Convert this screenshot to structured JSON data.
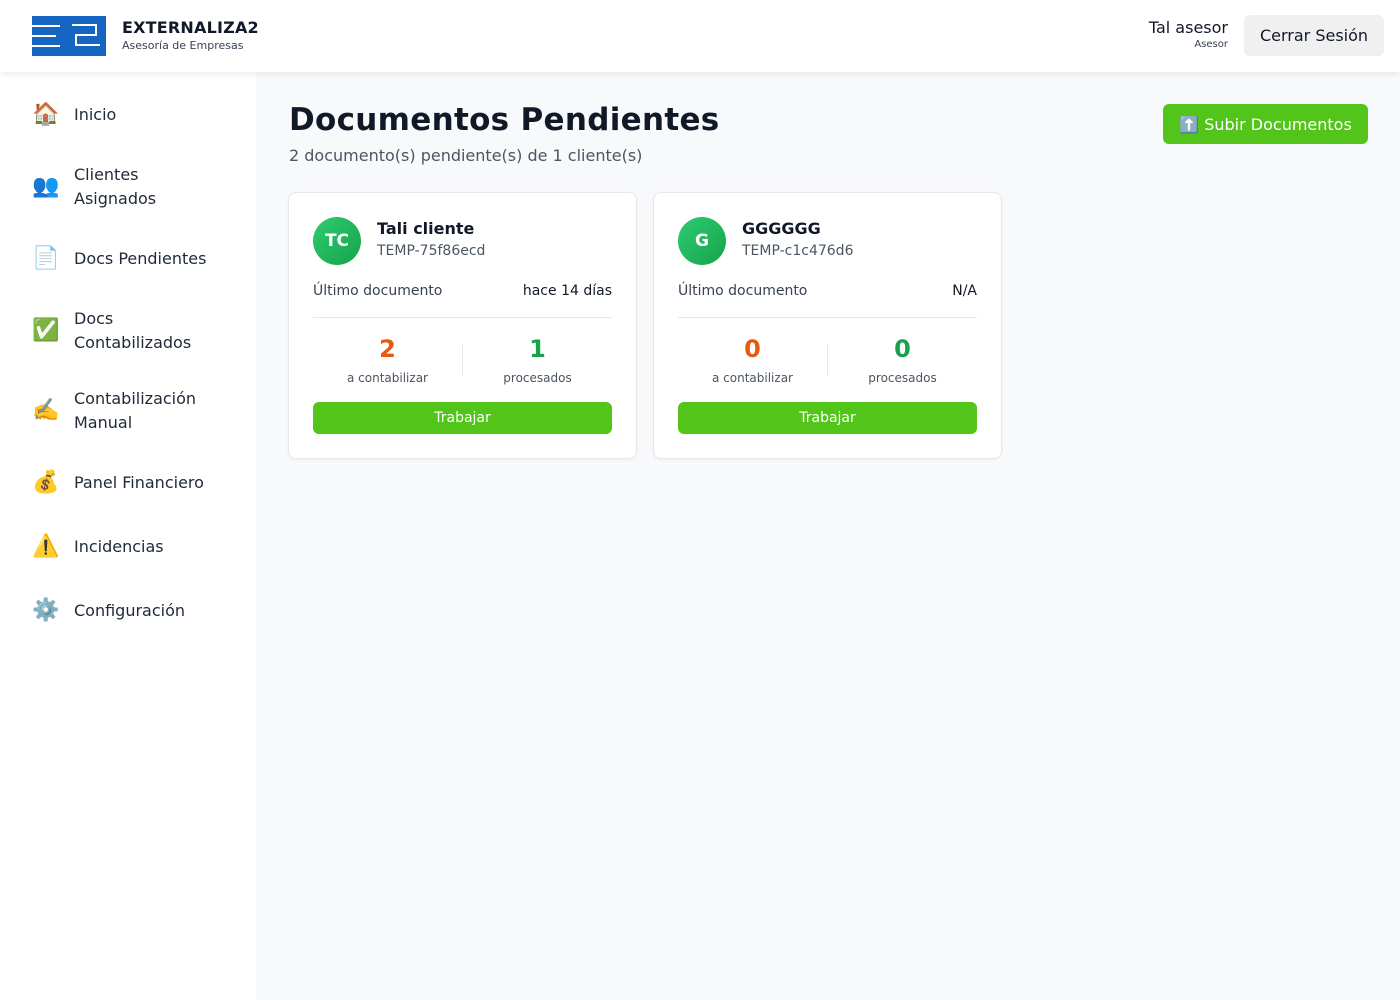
{
  "header": {
    "brand_name": "EXTERNALIZA2",
    "brand_sub": "Asesoría de Empresas",
    "user_name": "Tal asesor",
    "user_role": "Asesor",
    "logout_label": "Cerrar Sesión",
    "brand_color": "#1565c0"
  },
  "sidebar": {
    "items": [
      {
        "icon": "house-icon",
        "glyph": "🏠",
        "label": "Inicio"
      },
      {
        "icon": "users-icon",
        "glyph": "👥",
        "label": "Clientes Asignados"
      },
      {
        "icon": "document-icon",
        "glyph": "📄",
        "label": "Docs Pendientes"
      },
      {
        "icon": "check-icon",
        "glyph": "✅",
        "label": "Docs Contabilizados"
      },
      {
        "icon": "writing-hand-icon",
        "glyph": "✍️",
        "label": "Contabilización Manual"
      },
      {
        "icon": "money-bag-icon",
        "glyph": "💰",
        "label": "Panel Financiero"
      },
      {
        "icon": "warning-icon",
        "glyph": "⚠️",
        "label": "Incidencias"
      },
      {
        "icon": "gear-icon",
        "glyph": "⚙️",
        "label": "Configuración"
      }
    ]
  },
  "main": {
    "title": "Documentos Pendientes",
    "subtitle": "2 documento(s) pendiente(s) de 1 cliente(s)",
    "upload_icon": "⬆️",
    "upload_label": "Subir Documentos",
    "accent_color": "#52c41a",
    "cards": [
      {
        "initials": "TC",
        "name": "Tali cliente",
        "code": "TEMP-75f86ecd",
        "last_label": "Último documento",
        "last_value": "hace 14 días",
        "pending_count": "2",
        "pending_label": "a contabilizar",
        "processed_count": "1",
        "processed_label": "procesados",
        "button_label": "Trabajar"
      },
      {
        "initials": "G",
        "name": "GGGGGG",
        "code": "TEMP-c1c476d6",
        "last_label": "Último documento",
        "last_value": "N/A",
        "pending_count": "0",
        "pending_label": "a contabilizar",
        "processed_count": "0",
        "processed_label": "procesados",
        "button_label": "Trabajar"
      }
    ],
    "pending_color": "#e8590c",
    "processed_color": "#16a34a"
  }
}
